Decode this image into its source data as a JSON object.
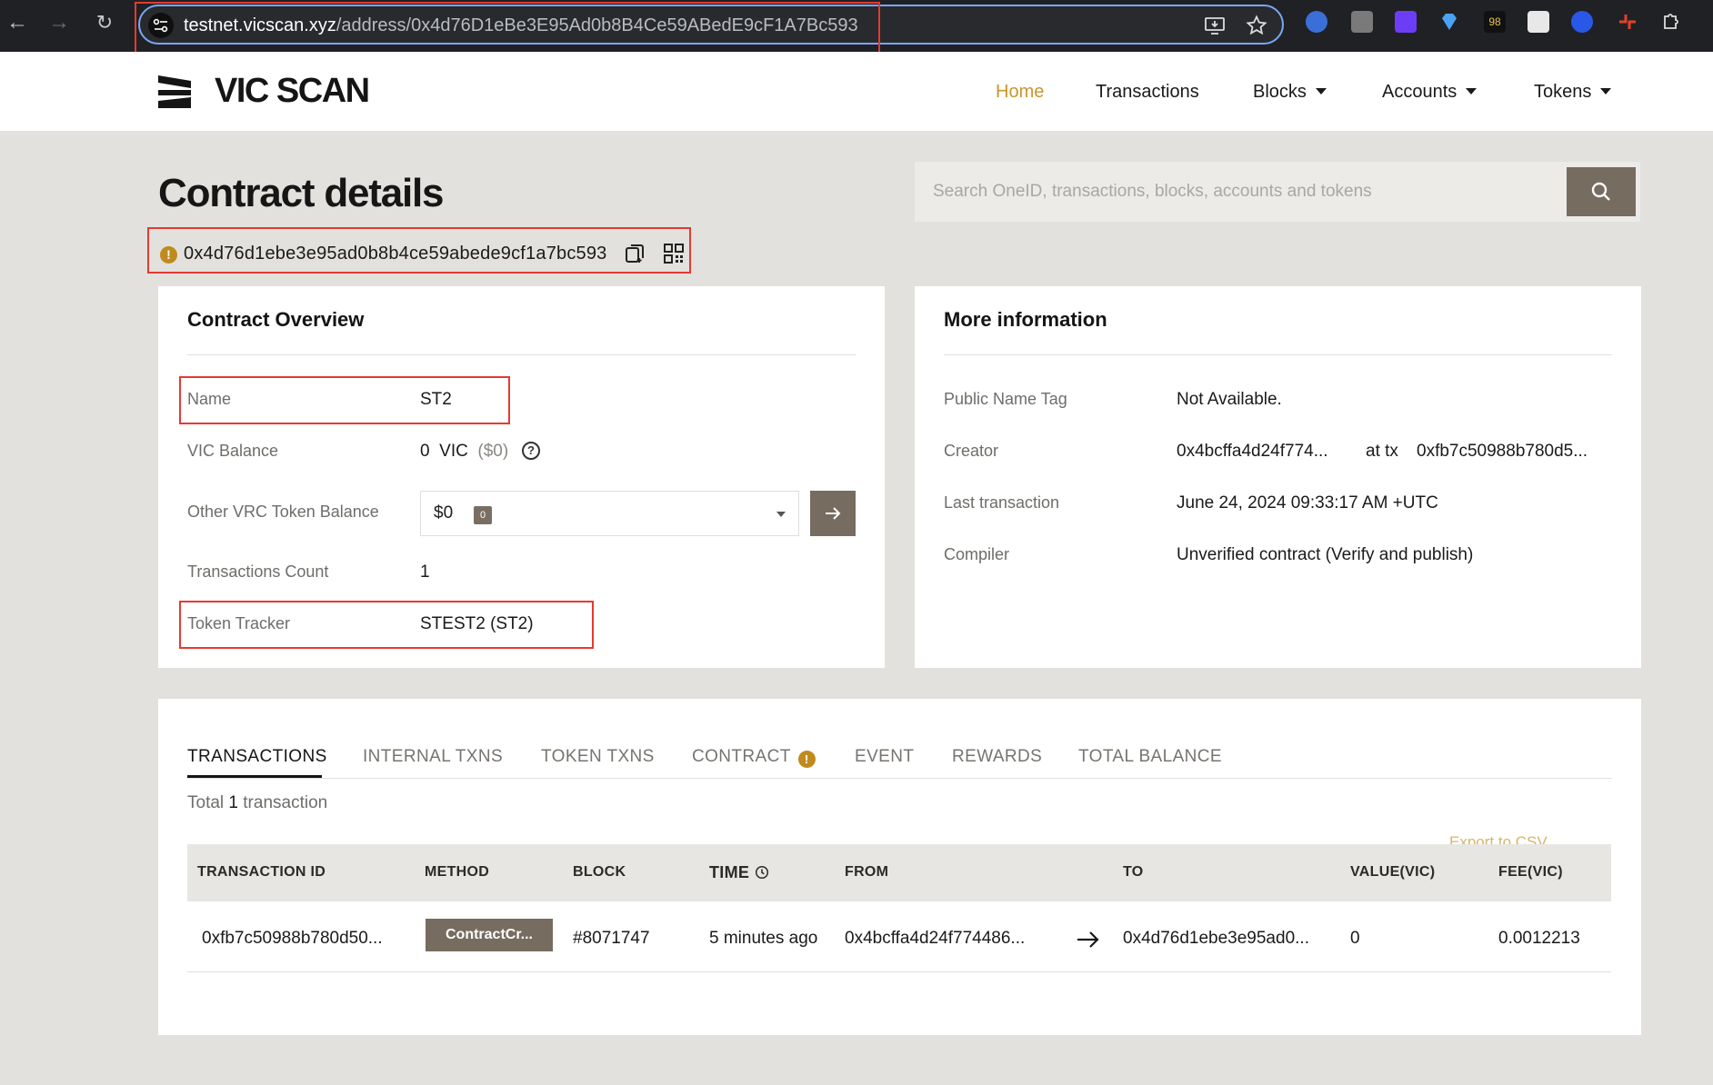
{
  "browser": {
    "url_host": "testnet.vicscan.xyz",
    "url_path": "/address/0x4d76D1eBe3E95Ad0b8B4Ce59ABedE9cF1A7Bc593",
    "icons": [
      "back-icon",
      "forward-icon",
      "reload-icon",
      "site-info-icon",
      "install-app-icon",
      "bookmark-star-icon"
    ],
    "extensions": [
      "translate-extension-icon",
      "camera-extension-icon",
      "purple-extension-icon",
      "diamond-extension-icon",
      "98-extension-icon",
      "box-extension-icon",
      "target-extension-icon",
      "red-extension-icon",
      "puzzle-extensions-icon"
    ]
  },
  "header": {
    "logo_text": "VIC SCAN",
    "nav": {
      "home": "Home",
      "transactions": "Transactions",
      "blocks": "Blocks",
      "accounts": "Accounts",
      "tokens": "Tokens"
    }
  },
  "page": {
    "title": "Contract details",
    "address": "0x4d76d1ebe3e95ad0b8b4ce59abede9cf1a7bc593",
    "search_placeholder": "Search OneID, transactions, blocks, accounts and tokens"
  },
  "overview": {
    "title": "Contract Overview",
    "name_label": "Name",
    "name_value": "ST2",
    "balance_label": "VIC Balance",
    "balance_value": "0",
    "balance_unit": "VIC",
    "balance_usd": "($0)",
    "vrc_label": "Other VRC Token Balance",
    "vrc_value": "$0",
    "vrc_count": "0",
    "txcount_label": "Transactions Count",
    "txcount_value": "1",
    "tracker_label": "Token Tracker",
    "tracker_value": "STEST2 (ST2)"
  },
  "more_info": {
    "title": "More information",
    "tag_label": "Public Name Tag",
    "tag_value": "Not Available.",
    "creator_label": "Creator",
    "creator_address": "0x4bcffa4d24f774...",
    "creator_at_tx": "at tx",
    "creator_tx": "0xfb7c50988b780d5...",
    "last_tx_label": "Last transaction",
    "last_tx_value": "June 24, 2024 09:33:17 AM +UTC",
    "compiler_label": "Compiler",
    "compiler_value": "Unverified contract (Verify and publish)"
  },
  "tabs": {
    "transactions": "TRANSACTIONS",
    "internal": "INTERNAL TXNS",
    "token": "TOKEN TXNS",
    "contract": "CONTRACT",
    "event": "EVENT",
    "rewards": "REWARDS",
    "total_balance": "TOTAL BALANCE"
  },
  "table": {
    "total_prefix": "Total",
    "total_count": "1",
    "total_suffix": "transaction",
    "export": "Export to CSV",
    "headers": {
      "tx_id": "TRANSACTION ID",
      "method": "METHOD",
      "block": "BLOCK",
      "time": "TIME",
      "from": "FROM",
      "to": "TO",
      "value": "VALUE(VIC)",
      "fee": "FEE(VIC)"
    },
    "rows": [
      {
        "tx_id": "0xfb7c50988b780d50...",
        "method": "ContractCr...",
        "block": "#8071747",
        "time": "5 minutes ago",
        "from": "0x4bcffa4d24f774486...",
        "to": "0x4d76d1ebe3e95ad0...",
        "value": "0",
        "fee": "0.0012213"
      }
    ]
  },
  "colors": {
    "accent_gold": "#c9952e",
    "brown_button": "#776c60",
    "highlight_red": "#e53a32",
    "warning": "#c08a1f"
  }
}
